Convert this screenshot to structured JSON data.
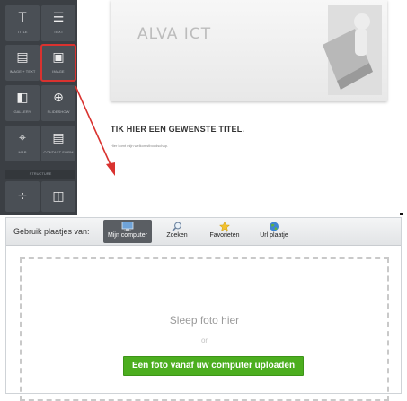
{
  "sidebar": {
    "tiles": [
      {
        "glyph": "T",
        "label": "title"
      },
      {
        "glyph": "☰",
        "label": "text"
      },
      {
        "glyph": "▤",
        "label": "image + text"
      },
      {
        "glyph": "▣",
        "label": "image"
      },
      {
        "glyph": "◧",
        "label": "gallery"
      },
      {
        "glyph": "⊕",
        "label": "slideshow"
      },
      {
        "glyph": "⌖",
        "label": "map"
      },
      {
        "glyph": "▤",
        "label": "contact form"
      },
      {
        "glyph": "÷",
        "label": ""
      },
      {
        "glyph": "◫",
        "label": ""
      }
    ],
    "section_label": "structure"
  },
  "canvas": {
    "brand": "ALVA ICT",
    "title": "TIK HIER EEN GEWENSTE TITEL.",
    "subtitle": "Hier komt mijn welkomstboodschap."
  },
  "dialog": {
    "label": "Gebruik plaatjes van:",
    "sources": [
      {
        "label": "Mijn computer",
        "icon": "computer-icon",
        "active": true
      },
      {
        "label": "Zoeken",
        "icon": "search-icon",
        "active": false
      },
      {
        "label": "Favorieten",
        "icon": "star-icon",
        "active": false
      },
      {
        "label": "Url plaatje",
        "icon": "globe-icon",
        "active": false
      }
    ],
    "drop_text": "Sleep foto hier",
    "or_text": "or",
    "upload_button": "Een foto vanaf uw computer uploaden"
  },
  "colors": {
    "sidebar": "#3b3f44",
    "highlight": "#d9322f",
    "upload_button": "#4cae1f",
    "active_source": "#5a5e63"
  }
}
